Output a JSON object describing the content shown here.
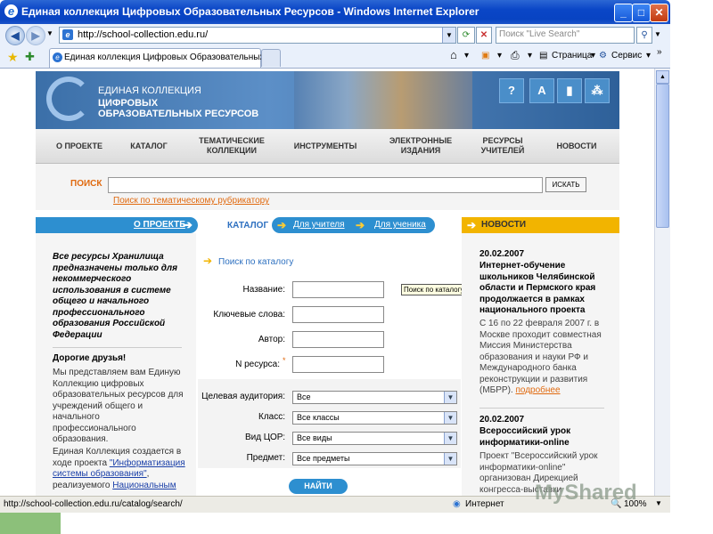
{
  "window": {
    "title": "Единая коллекция Цифровых Образовательных Ресурсов - Windows Internet Explorer",
    "address": "http://school-collection.edu.ru/",
    "search_placeholder": "Поиск \"Live Search\"",
    "tab_title": "Единая коллекция Цифровых Образовательных Р...",
    "cmd_page": "Страница",
    "cmd_tools": "Сервис"
  },
  "site": {
    "logo_line1": "ЕДИНАЯ КОЛЛЕКЦИЯ",
    "logo_line2": "ЦИФРОВЫХ",
    "logo_line3": "ОБРАЗОВАТЕЛЬНЫХ РЕСУРСОВ",
    "menu": [
      "О ПРОЕКТЕ",
      "КАТАЛОГ",
      "ТЕМАТИЧЕСКИЕ КОЛЛЕКЦИИ",
      "ИНСТРУМЕНТЫ",
      "ЭЛЕКТРОННЫЕ ИЗДАНИЯ",
      "РЕСУРСЫ УЧИТЕЛЕЙ",
      "НОВОСТИ"
    ],
    "search_label": "ПОИСК",
    "search_button": "ИСКАТЬ",
    "rubricator_link": "Поиск по тематическому рубрикатору",
    "about_bar": "О ПРОЕКТЕ",
    "catalog_label": "КАТАЛОГ",
    "for_teacher": "Для учителя",
    "for_student": "Для ученика",
    "news_bar": "НОВОСТИ"
  },
  "left": {
    "intro": "Все ресурсы Хранилища предназначены только для некоммерческого использования в системе общего и начального профессионального образования Российской Федерации",
    "greeting": "Дорогие друзья!",
    "para1": "Мы представляем вам Единую Коллекцию цифровых образовательных ресурсов для учреждений общего и начального профессионального образования.",
    "para2_start": "Единая Коллекция создается в ходе проекта",
    "para2_link": "\"Информатизация системы образования\"",
    "para2_mid": ", реализуемого",
    "para2_link2": "Национальным"
  },
  "form": {
    "heading": "Поиск по каталогу",
    "tooltip": "Поиск по каталогу",
    "name_label": "Название:",
    "keywords_label": "Ключевые слова:",
    "author_label": "Автор:",
    "resource_label": "N ресурса:",
    "audience_label": "Целевая аудитория:",
    "audience_value": "Все",
    "class_label": "Класс:",
    "class_value": "Все классы",
    "type_label": "Вид ЦОР:",
    "type_value": "Все виды",
    "subject_label": "Предмет:",
    "subject_value": "Все предметы",
    "find_button": "НАЙТИ"
  },
  "news": [
    {
      "date": "20.02.2007",
      "title": "Интернет-обучение школьников Челябинской области и Пермского края продолжается в рамках национального проекта",
      "text": "С 16 по 22 февраля 2007 г. в Москве проходит совместная Миссия Министерства образования и науки РФ и Международного банка реконструкции и развития (МБРР).",
      "more": "подробнее"
    },
    {
      "date": "20.02.2007",
      "title": "Всероссийский урок информатики-online",
      "text": "Проект \"Всероссийский урок информатики-online\" организован Дирекцией конгресса-выставки"
    }
  ],
  "status": {
    "url": "http://school-collection.edu.ru/catalog/search/",
    "zone": "Интернет",
    "zoom": "100%"
  },
  "watermark": "MyShared"
}
